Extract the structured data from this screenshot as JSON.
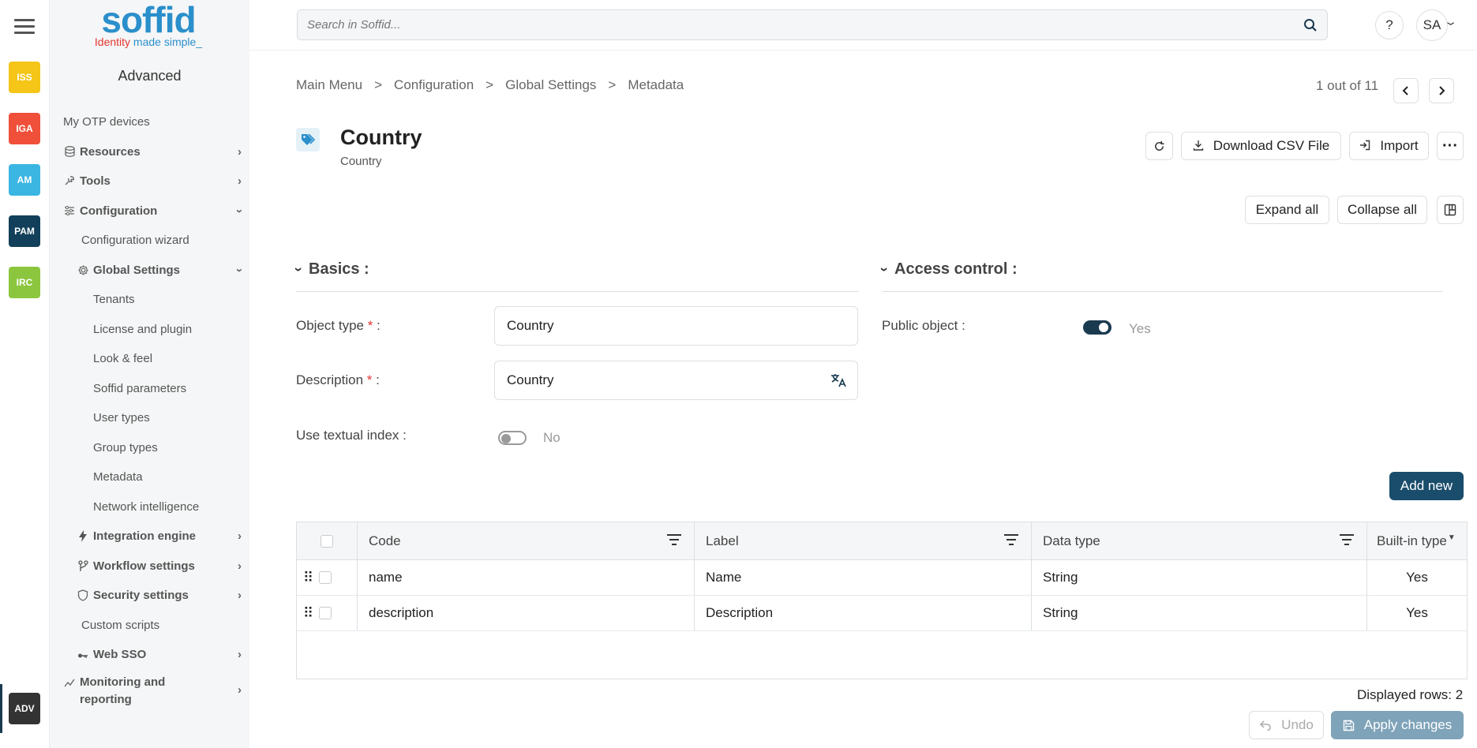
{
  "colors": {
    "primary": "#1a4d6b",
    "accent": "#2a8fcb",
    "required": "#e3342f",
    "apply_disabled": "#7fa3b9"
  },
  "apps": [
    {
      "label": "ISS",
      "color": "#f5c518"
    },
    {
      "label": "IGA",
      "color": "#f0503a"
    },
    {
      "label": "AM",
      "color": "#3bb6e3"
    },
    {
      "label": "PAM",
      "color": "#12405a"
    },
    {
      "label": "IRC",
      "color": "#8cc63f"
    },
    {
      "label": "ADV",
      "color": "#333333"
    }
  ],
  "logo": {
    "word": "soffid",
    "tagline_a": "Identity",
    "tagline_b": " made simple_"
  },
  "sidebar": {
    "title": "Advanced",
    "items": [
      {
        "label": "My OTP devices"
      },
      {
        "label": "Resources",
        "icon": "database-icon"
      },
      {
        "label": "Tools",
        "icon": "wrench-icon"
      },
      {
        "label": "Configuration",
        "icon": "sliders-icon"
      },
      {
        "label": "Configuration wizard"
      },
      {
        "label": "Global Settings",
        "icon": "gear-icon"
      },
      {
        "label": "Tenants"
      },
      {
        "label": "License and plugin"
      },
      {
        "label": "Look & feel"
      },
      {
        "label": "Soffid parameters"
      },
      {
        "label": "User types"
      },
      {
        "label": "Group types"
      },
      {
        "label": "Metadata"
      },
      {
        "label": "Network intelligence"
      },
      {
        "label": "Integration engine",
        "icon": "bolt-icon"
      },
      {
        "label": "Workflow settings",
        "icon": "workflow-icon"
      },
      {
        "label": "Security settings",
        "icon": "shield-icon"
      },
      {
        "label": "Custom scripts"
      },
      {
        "label": "Web SSO",
        "icon": "key-icon"
      },
      {
        "label": "Monitoring and reporting",
        "icon": "chart-icon"
      }
    ]
  },
  "search": {
    "placeholder": "Search in Soffid..."
  },
  "header": {
    "help": "?",
    "user_initials": "SA"
  },
  "breadcrumb": [
    "Main Menu",
    "Configuration",
    "Global Settings",
    "Metadata"
  ],
  "breadcrumb_sep": ">",
  "pager": {
    "text": "1 out of 11"
  },
  "page": {
    "title": "Country",
    "subtitle": "Country"
  },
  "toolbar": {
    "download": "Download CSV File",
    "import": "Import",
    "expand_all": "Expand all",
    "collapse_all": "Collapse all"
  },
  "basics": {
    "title": "Basics :",
    "object_type_label": "Object type",
    "object_type_value": "Country",
    "description_label": "Description",
    "description_value": "Country",
    "textual_index_label": "Use textual index :",
    "textual_index_value": "No"
  },
  "access": {
    "title": "Access control :",
    "public_label": "Public object :",
    "public_value": "Yes"
  },
  "req_mark": "*",
  "colon": " :",
  "grid": {
    "add_new": "Add new",
    "columns": [
      "Code",
      "Label",
      "Data type",
      "Built-in type"
    ],
    "rows": [
      {
        "code": "name",
        "label": "Name",
        "type": "String",
        "builtin": "Yes"
      },
      {
        "code": "description",
        "label": "Description",
        "type": "String",
        "builtin": "Yes"
      }
    ],
    "displayed_rows": "Displayed rows: 2"
  },
  "footer": {
    "undo": "Undo",
    "apply": "Apply changes"
  }
}
